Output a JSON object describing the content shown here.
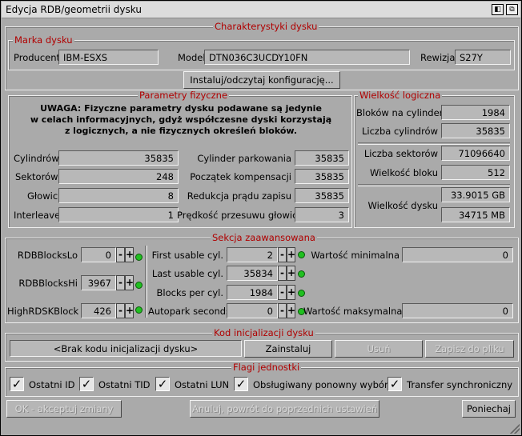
{
  "window": {
    "title": "Edycja RDB/geometrii dysku",
    "btn_iconify": "◧",
    "btn_depth": "⧉"
  },
  "characteristics": {
    "title": "Charakterystyki dysku",
    "brand_group": "Marka dysku",
    "manufacturer_label": "Producent",
    "manufacturer_value": "IBM-ESXS",
    "model_label": "Model",
    "model_value": "DTN036C3UCDY10FN",
    "revision_label": "Rewizja",
    "revision_value": "S27Y",
    "install_button": "Instaluj/odczytaj konfigurację..."
  },
  "physical": {
    "title": "Parametry fizyczne",
    "warning_lines": [
      "UWAGA: Fizyczne parametry dysku podawane są jedynie",
      "w celach informacyjnych, gdyż współczesne dyski korzystają",
      "z logicznych, a nie fizycznych określeń bloków."
    ],
    "cylinders_label": "Cylindrów",
    "cylinders_value": "35835",
    "sectors_label": "Sektorów",
    "sectors_value": "248",
    "heads_label": "Głowic",
    "heads_value": "8",
    "interleave_label": "Interleave",
    "interleave_value": "1",
    "park_label": "Cylinder parkowania",
    "park_value": "35835",
    "precomp_label": "Początek kompensacji",
    "precomp_value": "35835",
    "reduced_label": "Redukcja prądu zapisu",
    "reduced_value": "35835",
    "steprate_label": "Prędkość przesuwu głowic",
    "steprate_value": "3"
  },
  "logical": {
    "title": "Wielkość logiczna",
    "blocks_per_cyl_label": "Bloków na cylinder",
    "blocks_per_cyl_value": "1984",
    "cyl_count_label": "Liczba cylindrów",
    "cyl_count_value": "35835",
    "sector_count_label": "Liczba sektorów",
    "sector_count_value": "71096640",
    "block_size_label": "Wielkość bloku",
    "block_size_value": "512",
    "disk_size_label": "Wielkość dysku",
    "disk_size_gb": "33.9015 GB",
    "disk_size_mb": "34715 MB"
  },
  "advanced": {
    "title": "Sekcja zaawansowana",
    "rdb_lo_label": "RDBBlocksLo",
    "rdb_lo_value": "0",
    "rdb_hi_label": "RDBBlocksHi",
    "rdb_hi_value": "3967",
    "high_rdsk_label": "HighRDSKBlock",
    "high_rdsk_value": "426",
    "first_usable_label": "First usable cyl.",
    "first_usable_value": "2",
    "last_usable_label": "Last usable cyl.",
    "last_usable_value": "35834",
    "blocks_per_cyl_label": "Blocks per cyl.",
    "blocks_per_cyl_value": "1984",
    "autopark_label": "Autopark seconds",
    "autopark_value": "0",
    "min_label": "Wartość minimalna",
    "min_value": "0",
    "max_label": "Wartość maksymalna",
    "max_value": "0",
    "minus": "-",
    "plus": "+"
  },
  "init_code": {
    "title": "Kod inicjalizacji dysku",
    "none_value": "<Brak kodu inicjalizacji dysku>",
    "install_button": "Zainstaluj",
    "remove_button": "Usuń",
    "save_button": "Zapisz do pliku"
  },
  "flags": {
    "title": "Flagi jednostki",
    "check_mark": "✓",
    "last_id": "Ostatni ID",
    "last_tid": "Ostatni TID",
    "last_lun": "Ostatni LUN",
    "reselect": "Obsługiwany ponowny wybór",
    "sync": "Transfer synchroniczny"
  },
  "footer": {
    "ok_button": "OK - akceptuj zmiany",
    "revert_button": "Anuluj, powrót do poprzednich ustawień",
    "cancel_button": "Poniechaj"
  }
}
